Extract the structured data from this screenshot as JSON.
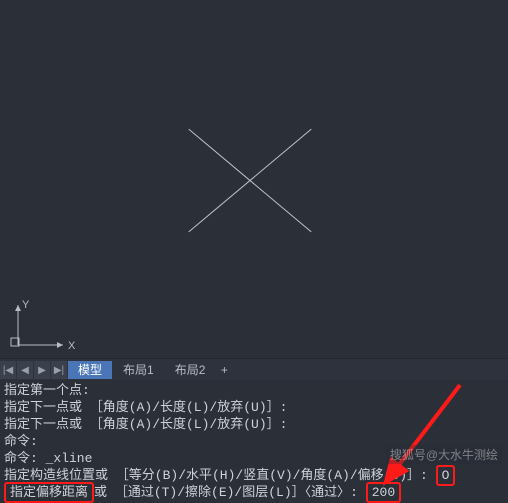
{
  "canvas": {
    "ucs": {
      "x_label": "X",
      "y_label": "Y"
    }
  },
  "tabs": {
    "nav_first": "|◀",
    "nav_prev": "◀",
    "nav_next": "▶",
    "nav_last": "▶|",
    "items": [
      {
        "label": "模型",
        "active": true
      },
      {
        "label": "布局1",
        "active": false
      },
      {
        "label": "布局2",
        "active": false
      }
    ],
    "plus": "+"
  },
  "command_log": {
    "lines": [
      "指定第一个点:",
      "指定下一点或 ［角度(A)/长度(L)/放弃(U)］:",
      "指定下一点或 ［角度(A)/长度(L)/放弃(U)］:",
      "命令:",
      "命令: _xline",
      "指定构造线位置或 ［等分(B)/水平(H)/竖直(V)/角度(A)/偏移(O)］:",
      "指定偏移距离"
    ],
    "line6_value": "O",
    "line7_prefix": "或 ［通过(T)/擦除(E)/图层(L)］〈通过〉:",
    "line7_value": "200"
  },
  "watermark": "搜狐号@大水牛测绘"
}
